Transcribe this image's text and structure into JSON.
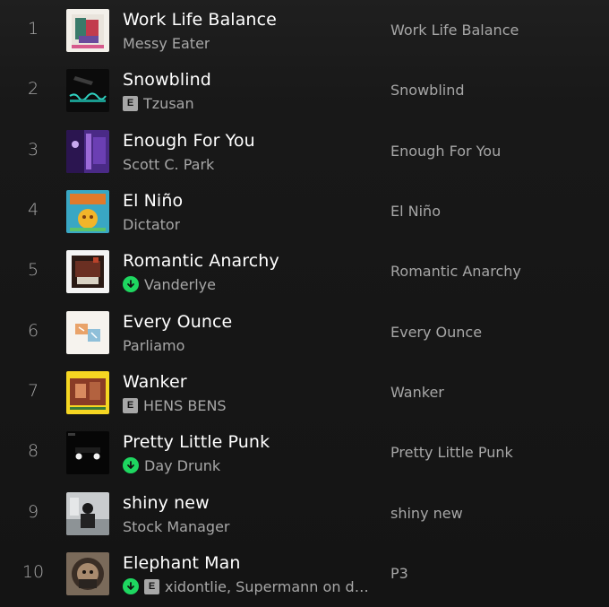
{
  "tracks": [
    {
      "number": "1",
      "title": "Work Life Balance",
      "artist": "Messy Eater",
      "album": "Work Life Balance",
      "explicit": false,
      "downloaded": false,
      "art": "work-life-balance-cover"
    },
    {
      "number": "2",
      "title": "Snowblind",
      "artist": "Tzusan",
      "album": "Snowblind",
      "explicit": true,
      "downloaded": false,
      "art": "snowblind-cover"
    },
    {
      "number": "3",
      "title": "Enough For You",
      "artist": "Scott C. Park",
      "album": "Enough For You",
      "explicit": false,
      "downloaded": false,
      "art": "enough-for-you-cover"
    },
    {
      "number": "4",
      "title": "El Niño",
      "artist": "Dictator",
      "album": "El Niño",
      "explicit": false,
      "downloaded": false,
      "art": "el-nino-cover"
    },
    {
      "number": "5",
      "title": "Romantic Anarchy",
      "artist": "Vanderlye",
      "album": "Romantic Anarchy",
      "explicit": false,
      "downloaded": true,
      "art": "romantic-anarchy-cover"
    },
    {
      "number": "6",
      "title": "Every Ounce",
      "artist": "Parliamo",
      "album": "Every Ounce",
      "explicit": false,
      "downloaded": false,
      "art": "every-ounce-cover"
    },
    {
      "number": "7",
      "title": "Wanker",
      "artist": "HENS BENS",
      "album": "Wanker",
      "explicit": true,
      "downloaded": false,
      "art": "wanker-cover"
    },
    {
      "number": "8",
      "title": "Pretty Little Punk",
      "artist": "Day Drunk",
      "album": "Pretty Little Punk",
      "explicit": false,
      "downloaded": true,
      "art": "pretty-little-punk-cover"
    },
    {
      "number": "9",
      "title": "shiny new",
      "artist": "Stock Manager",
      "album": "shiny new",
      "explicit": false,
      "downloaded": false,
      "art": "shiny-new-cover"
    },
    {
      "number": "10",
      "title": "Elephant Man",
      "artist": "xidontlie, Supermann on da...",
      "album": "P3",
      "explicit": true,
      "downloaded": true,
      "art": "elephant-man-cover"
    }
  ],
  "explicit_label": "E",
  "colors": {
    "accent_green": "#1ed760",
    "text_primary": "#ffffff",
    "text_secondary": "#a7a7a7",
    "background": "#121212"
  }
}
